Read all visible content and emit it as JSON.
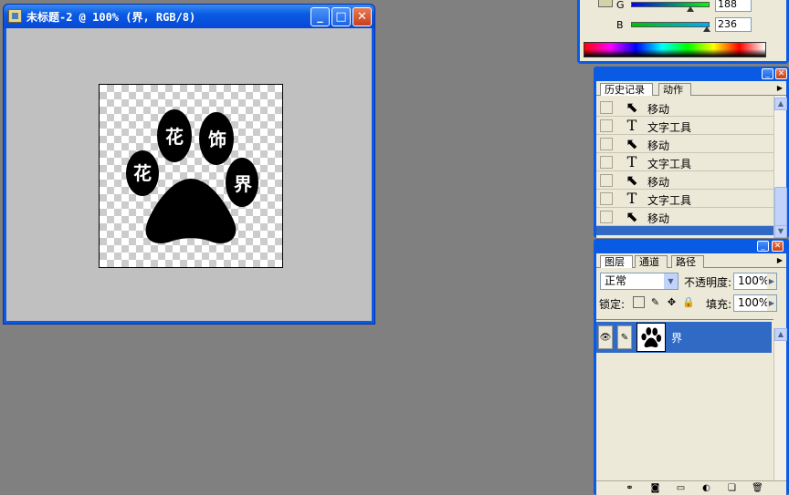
{
  "document_window": {
    "title": "未标题-2 @ 100% (界, RGB/8)",
    "minimize_symbol": "_",
    "maximize_symbol": "□",
    "close_symbol": "✕",
    "canvas_text": [
      "花",
      "饰",
      "花",
      "界"
    ]
  },
  "color_panel": {
    "rows": [
      {
        "label": "G",
        "value": "188",
        "gradient": [
          "#0000ff",
          "#00ff00"
        ],
        "thumb_fraction": 0.73
      },
      {
        "label": "B",
        "value": "236",
        "gradient": [
          "#00c000",
          "#00aaff"
        ],
        "thumb_fraction": 0.93
      }
    ],
    "swatch_color": "#D1D5A6"
  },
  "history_panel": {
    "tabs": [
      {
        "label": "历史记录",
        "active": true
      },
      {
        "label": "动作",
        "active": false
      }
    ],
    "items": [
      {
        "label": "移动",
        "icon": "move-icon"
      },
      {
        "label": "文字工具",
        "icon": "type-tool-icon"
      },
      {
        "label": "移动",
        "icon": "move-icon"
      },
      {
        "label": "文字工具",
        "icon": "type-tool-icon"
      },
      {
        "label": "移动",
        "icon": "move-icon"
      },
      {
        "label": "文字工具",
        "icon": "type-tool-icon"
      },
      {
        "label": "移动",
        "icon": "move-icon"
      }
    ]
  },
  "layers_panel": {
    "tabs": [
      {
        "label": "图层",
        "active": true
      },
      {
        "label": "通道",
        "active": false
      },
      {
        "label": "路径",
        "active": false
      }
    ],
    "blend_mode": "正常",
    "opacity_label": "不透明度:",
    "opacity_value": "100%",
    "lock_label": "锁定:",
    "fill_label": "填充:",
    "fill_value": "100%",
    "layers": [
      {
        "name": "界",
        "selected": true
      }
    ]
  },
  "colors": {
    "xp_blue": "#0A5BE3",
    "panel_bg": "#ECE9D8",
    "selection": "#316AC5",
    "workspace": "#808080"
  }
}
